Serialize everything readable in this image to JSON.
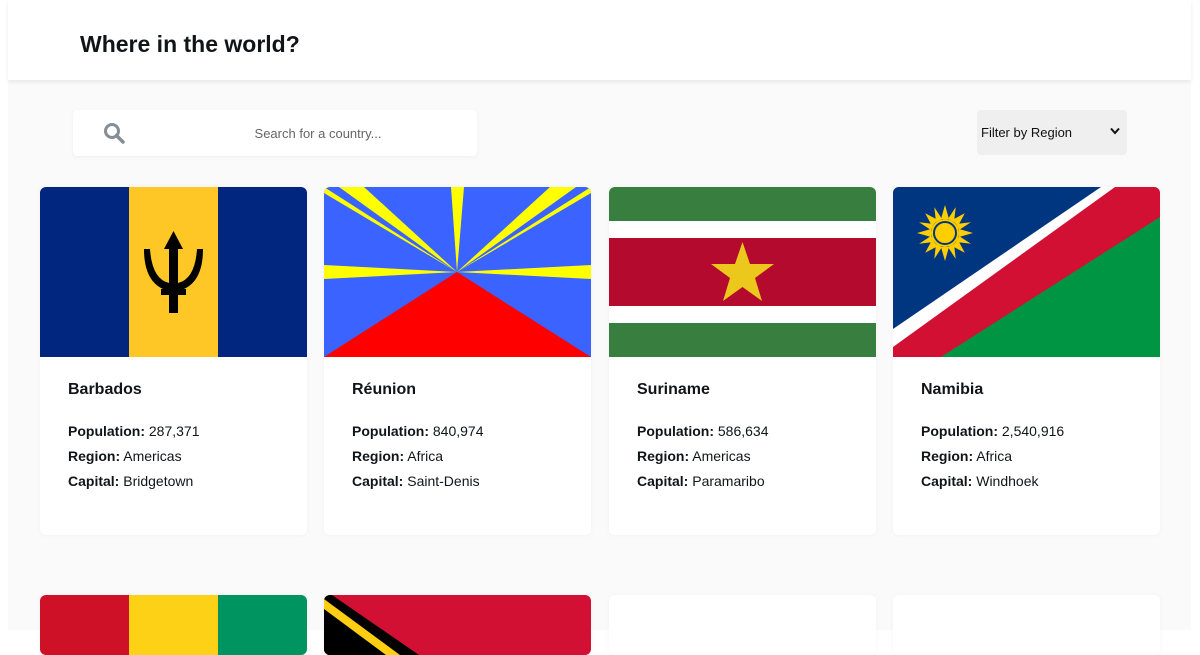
{
  "header": {
    "title": "Where in the world?"
  },
  "search": {
    "placeholder": "Search for a country..."
  },
  "filter": {
    "label": "Filter by Region"
  },
  "labels": {
    "population": "Population:",
    "region": "Region:",
    "capital": "Capital:"
  },
  "countries": [
    {
      "name": "Barbados",
      "population": "287,371",
      "region": "Americas",
      "capital": "Bridgetown"
    },
    {
      "name": "Réunion",
      "population": "840,974",
      "region": "Africa",
      "capital": "Saint-Denis"
    },
    {
      "name": "Suriname",
      "population": "586,634",
      "region": "Americas",
      "capital": "Paramaribo"
    },
    {
      "name": "Namibia",
      "population": "2,540,916",
      "region": "Africa",
      "capital": "Windhoek"
    }
  ],
  "colors": {
    "background": "#fafafa",
    "card": "#ffffff",
    "text": "#111517",
    "filter_bg": "#efefef"
  }
}
